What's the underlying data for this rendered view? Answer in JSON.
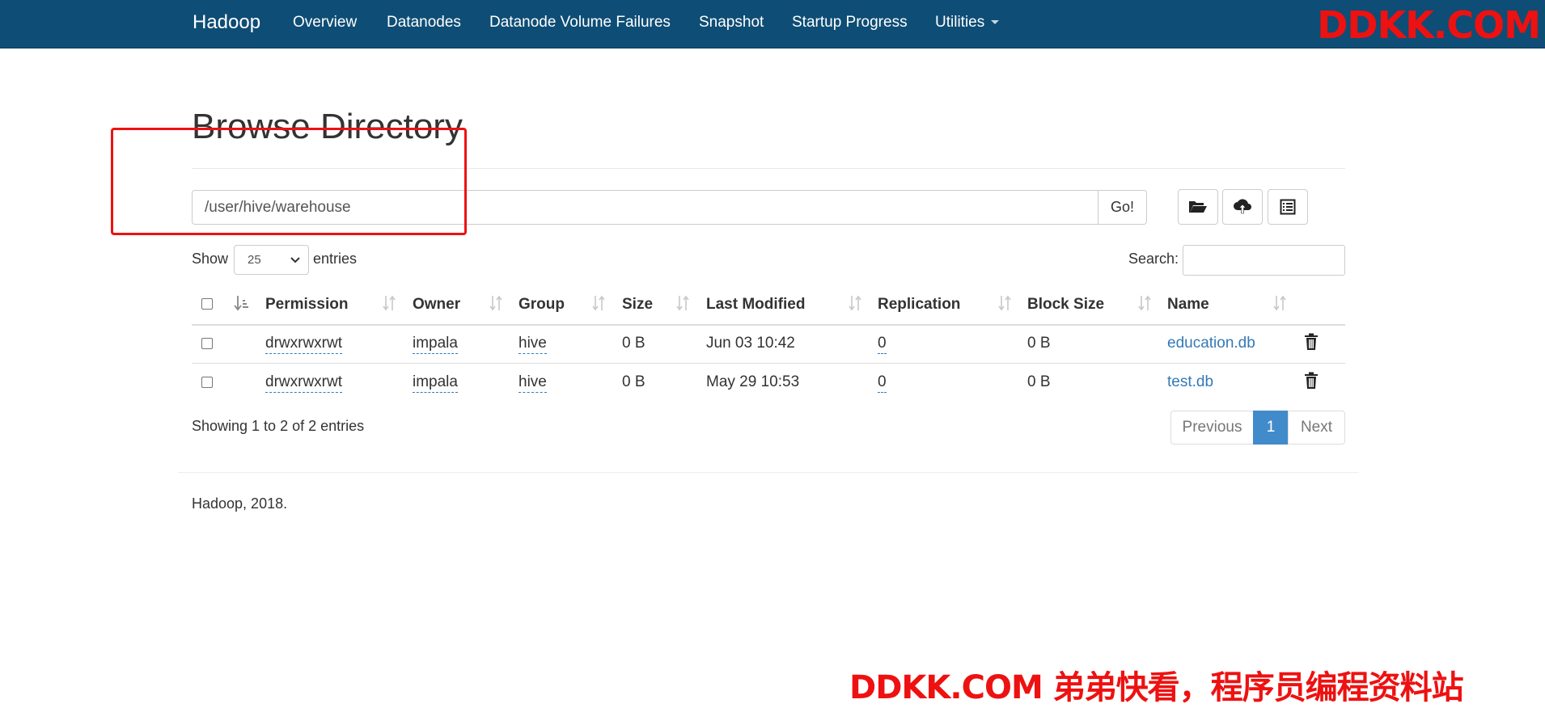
{
  "nav": {
    "brand": "Hadoop",
    "items": [
      "Overview",
      "Datanodes",
      "Datanode Volume Failures",
      "Snapshot",
      "Startup Progress",
      "Utilities"
    ]
  },
  "watermark": {
    "top": "DDKK.COM",
    "bottom": "DDKK.COM 弟弟快看，程序员编程资料站",
    "color": "#ee1111"
  },
  "page": {
    "title": "Browse Directory"
  },
  "path": {
    "value": "/user/hive/warehouse",
    "go_label": "Go!"
  },
  "toolbar": {
    "icons": [
      "folder-open-icon",
      "cloud-upload-icon",
      "list-alt-icon"
    ]
  },
  "table_controls": {
    "show_label": "Show",
    "page_length": "25",
    "entries_label": "entries",
    "search_label": "Search:"
  },
  "table": {
    "columns": [
      "Permission",
      "Owner",
      "Group",
      "Size",
      "Last Modified",
      "Replication",
      "Block Size",
      "Name"
    ],
    "rows": [
      {
        "permission": "drwxrwxrwt",
        "owner": "impala",
        "group": "hive",
        "size": "0 B",
        "last_modified": "Jun 03 10:42",
        "replication": "0",
        "block_size": "0 B",
        "name": "education.db"
      },
      {
        "permission": "drwxrwxrwt",
        "owner": "impala",
        "group": "hive",
        "size": "0 B",
        "last_modified": "May 29 10:53",
        "replication": "0",
        "block_size": "0 B",
        "name": "test.db"
      }
    ]
  },
  "pagination": {
    "info": "Showing 1 to 2 of 2 entries",
    "previous": "Previous",
    "current": "1",
    "next": "Next"
  },
  "footer": {
    "text": "Hadoop, 2018."
  },
  "colors": {
    "navbar": "#0e4d75",
    "link": "#337ab7",
    "active_page": "#428bca",
    "highlight_box": "#ee1111"
  }
}
